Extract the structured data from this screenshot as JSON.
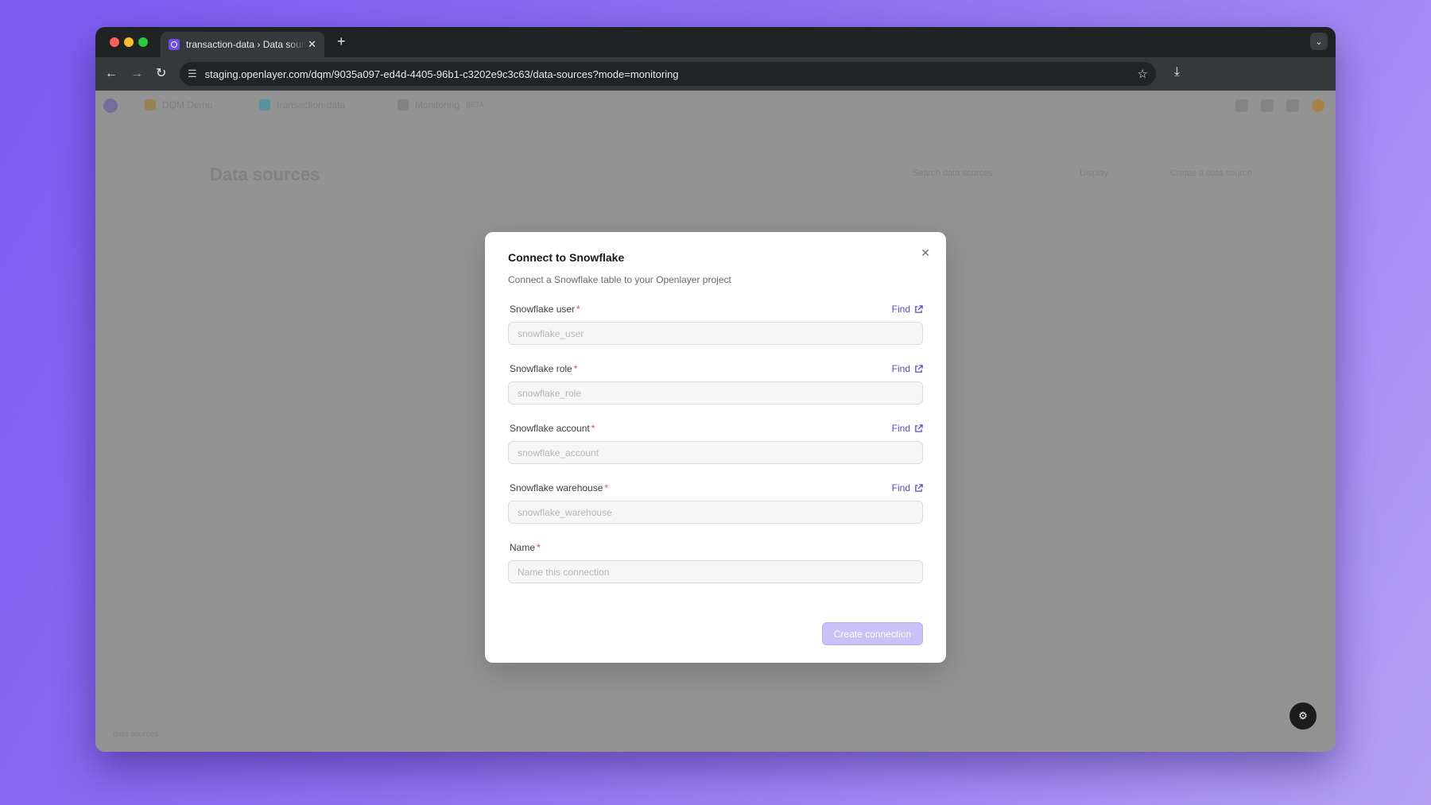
{
  "browser": {
    "tab_title": "transaction-data › Data sources",
    "tab_close": "✕",
    "new_tab": "+",
    "url": "staging.openlayer.com/dqm/9035a097-ed4d-4405-96b1-c3202e9c3c63/data-sources?mode=monitoring",
    "icons": {
      "back": "back-arrow-icon",
      "forward": "forward-arrow-icon",
      "reload": "reload-icon",
      "site_info": "site-info-icon",
      "bookmark": "star-icon",
      "download": "download-icon",
      "tab_menu": "chevron-down-icon"
    }
  },
  "app": {
    "breadcrumbs": [
      "DQM Demo",
      "transaction-data",
      "Monitoring"
    ],
    "breadcrumb_badge": "BETA",
    "page_title": "Data sources",
    "search_placeholder": "Search data sources",
    "display_label": "Display",
    "create_data_source_label": "Create a data source",
    "footer_hint": "data sources"
  },
  "modal": {
    "title": "Connect to Snowflake",
    "subtitle": "Connect a Snowflake table to your Openlayer project",
    "close": "✕",
    "find_label": "Find",
    "required_mark": "*",
    "fields": [
      {
        "label": "Snowflake user",
        "placeholder": "snowflake_user",
        "has_find": true
      },
      {
        "label": "Snowflake role",
        "placeholder": "snowflake_role",
        "has_find": true
      },
      {
        "label": "Snowflake account",
        "placeholder": "snowflake_account",
        "has_find": true
      },
      {
        "label": "Snowflake warehouse",
        "placeholder": "snowflake_warehouse",
        "has_find": true
      },
      {
        "label": "Name",
        "placeholder": "Name this connection",
        "has_find": false
      }
    ],
    "submit_label": "Create connection"
  },
  "colors": {
    "accent": "#5b45d6",
    "required": "#e5484d",
    "button_disabled": "#c9c2f6"
  }
}
